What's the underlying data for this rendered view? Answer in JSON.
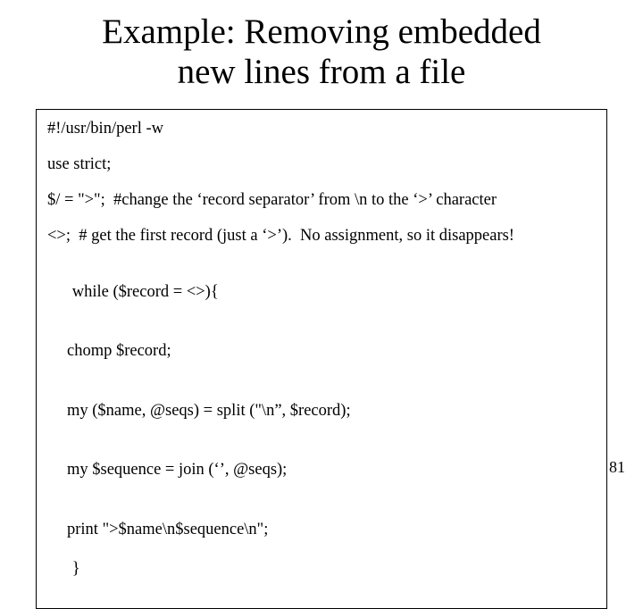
{
  "title_line1": "Example:  Removing embedded",
  "title_line2": "new lines from a file",
  "code": {
    "shebang": "#!/usr/bin/perl -w",
    "strict": "use strict;",
    "sep": "$/ = \">\";  #change the ‘record separator’ from \\n to the ‘>’ character",
    "first": "<>;  # get the first record (just a ‘>’).  No assignment, so it disappears!",
    "while": "while ($record = <>){",
    "b1": "chomp $record;",
    "b2": "my ($name, @seqs) = split (\"\\n”, $record);",
    "b3": "my $sequence = join (‘’, @seqs);",
    "b4": "print \">$name\\n$sequence\\n\";",
    "end": "}"
  },
  "page_number": "81"
}
